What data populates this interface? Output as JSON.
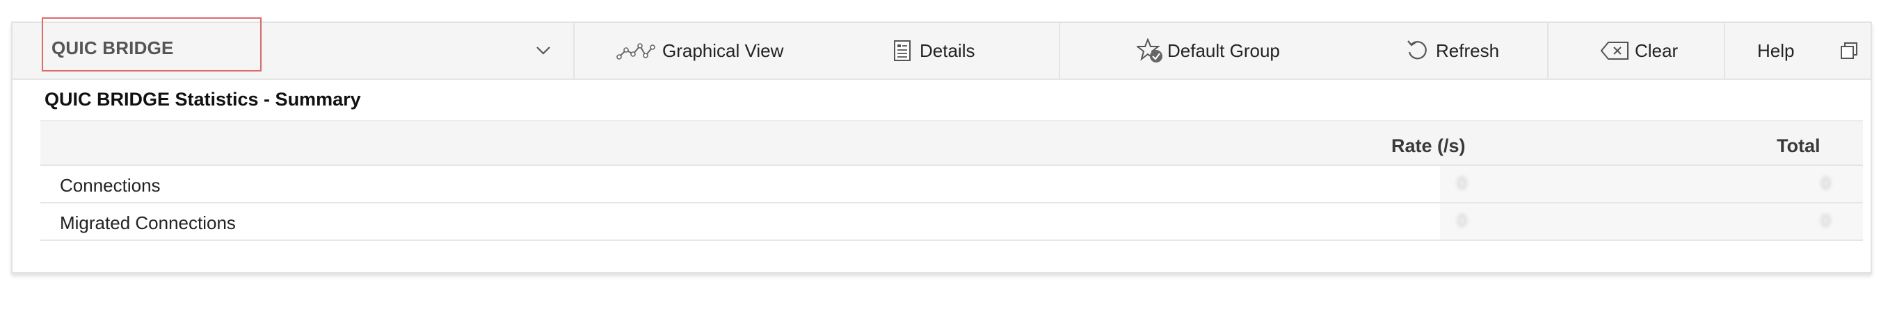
{
  "toolbar": {
    "selected_statistic": "QUIC BRIDGE",
    "graphical_view_label": "Graphical View",
    "details_label": "Details",
    "default_group_label": "Default Group",
    "refresh_label": "Refresh",
    "clear_label": "Clear",
    "help_label": "Help",
    "icons": {
      "graph": "line-graph-icon",
      "details": "document-list-icon",
      "default_group": "star-check-icon",
      "refresh": "refresh-icon",
      "clear": "backspace-clear-icon",
      "window": "restore-window-icon",
      "dropdown": "chevron-down-icon"
    }
  },
  "summary": {
    "title": "QUIC BRIDGE Statistics - Summary",
    "columns": {
      "rate": "Rate (/s)",
      "total": "Total"
    },
    "rows": [
      {
        "name": "Connections",
        "rate": "0",
        "total": "0"
      },
      {
        "name": "Migrated Connections",
        "rate": "0",
        "total": "0"
      }
    ]
  },
  "colors": {
    "toolbar_bg": "#f5f5f5",
    "highlight_border": "#e06a6a",
    "text": "#222222"
  }
}
